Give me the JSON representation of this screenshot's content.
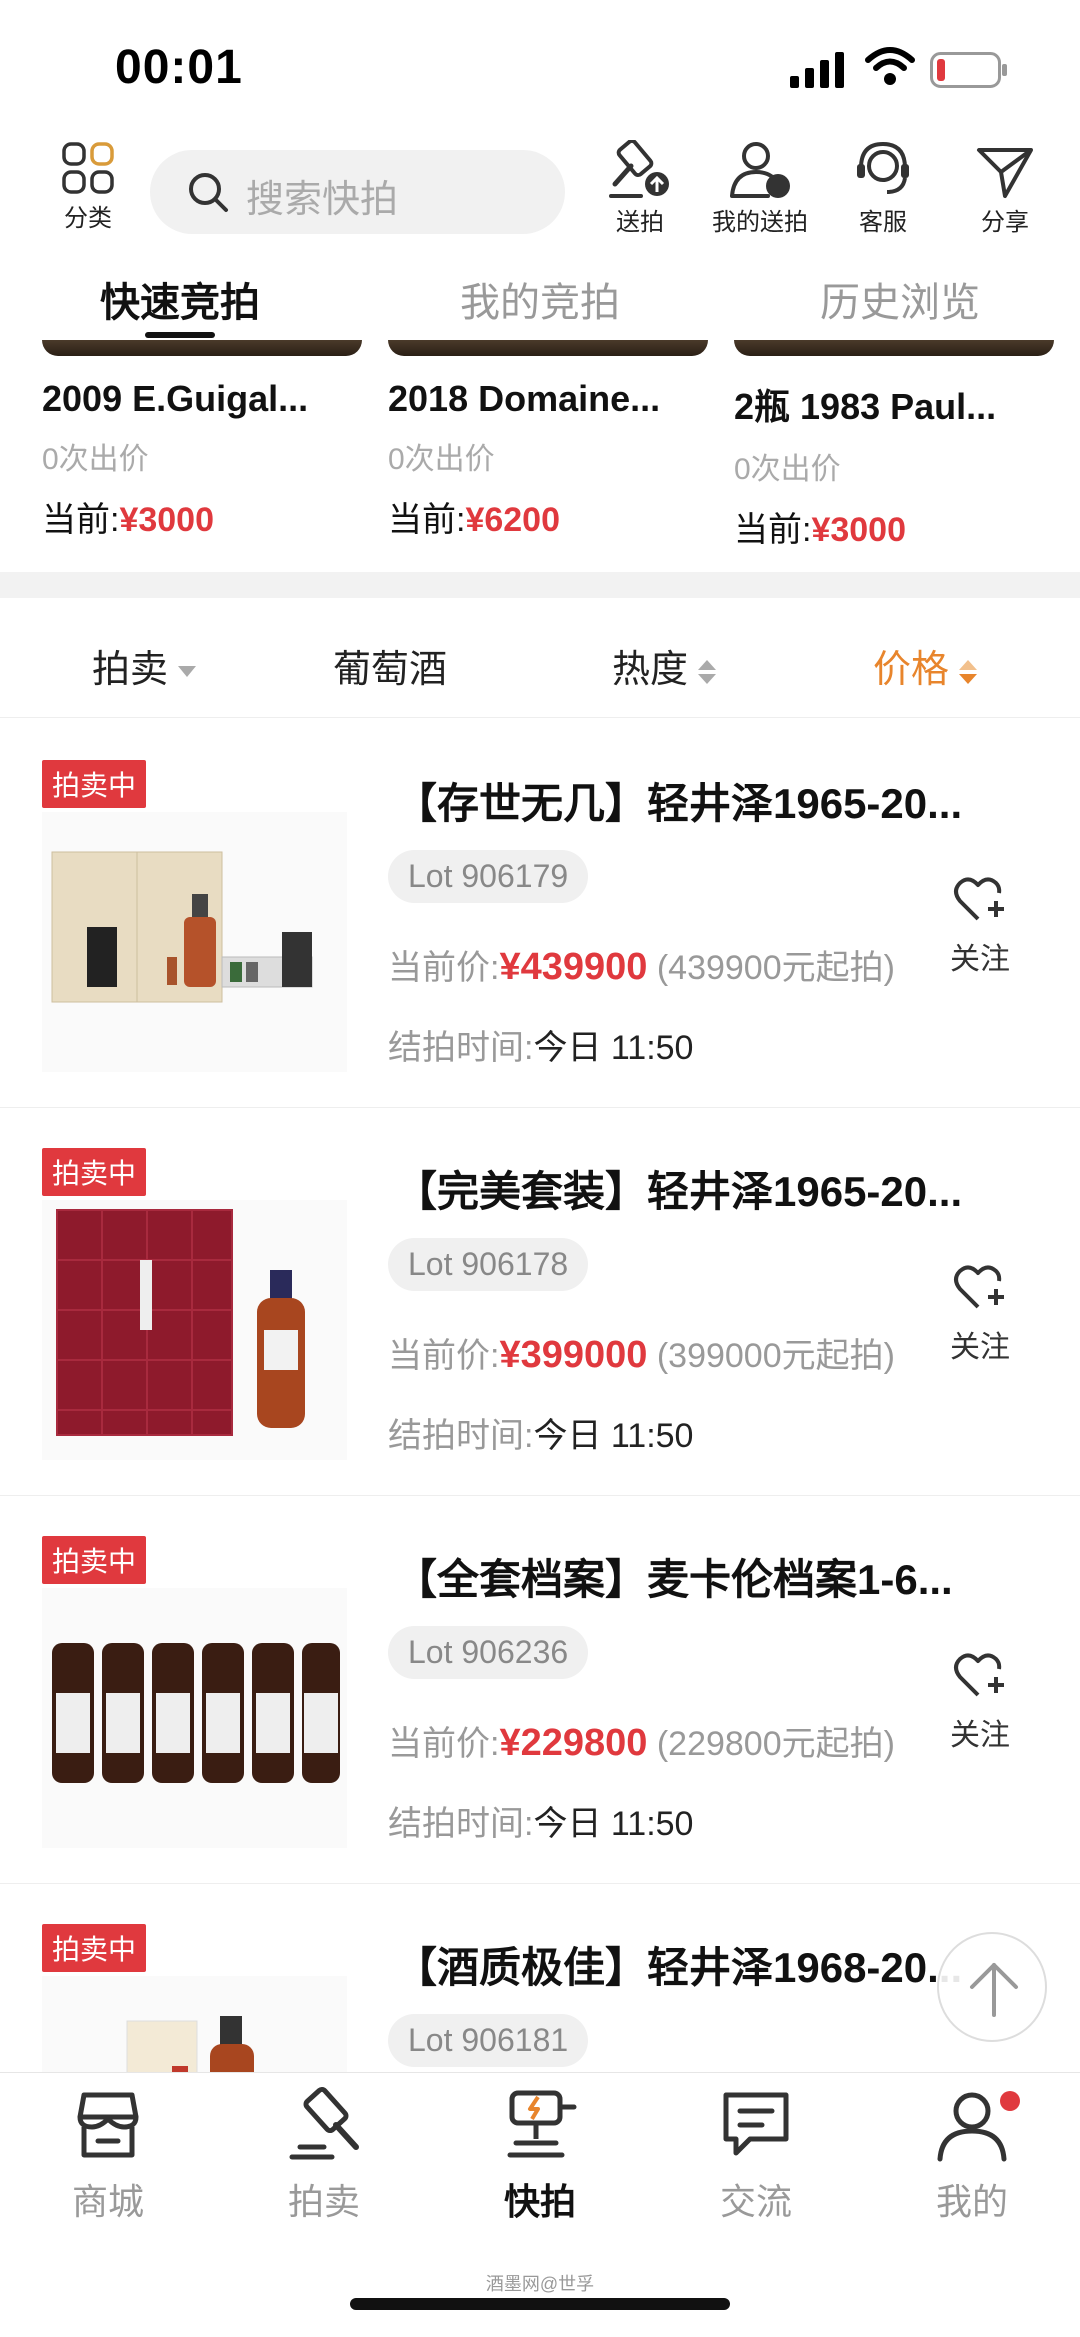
{
  "status_bar": {
    "time": "00:01"
  },
  "top_bar": {
    "category_label": "分类",
    "search_placeholder": "搜索快拍",
    "send_auction_label": "送拍",
    "my_send_label": "我的送拍",
    "service_label": "客服",
    "share_label": "分享"
  },
  "tabs": [
    {
      "label": "快速竞拍",
      "active": true
    },
    {
      "label": "我的竞拍",
      "active": false
    },
    {
      "label": "历史浏览",
      "active": false
    }
  ],
  "quick_cards": [
    {
      "title": "2009 E.Guigal...",
      "bids": "0次出价",
      "price_label": "当前:",
      "price": "¥3000"
    },
    {
      "title": "2018 Domaine...",
      "bids": "0次出价",
      "price_label": "当前:",
      "price": "¥6200"
    },
    {
      "title": "2瓶 1983 Paul...",
      "bids": "0次出价",
      "price_label": "当前:",
      "price": "¥3000"
    }
  ],
  "filters": [
    {
      "label": "拍卖",
      "control": "dropdown"
    },
    {
      "label": "葡萄酒",
      "control": "none"
    },
    {
      "label": "热度",
      "control": "sort"
    },
    {
      "label": "价格",
      "control": "sort",
      "active": true
    }
  ],
  "items": [
    {
      "badge": "拍卖中",
      "title": "【存世无几】轻井泽1965-20...",
      "lot": "Lot 906179",
      "price_label": "当前价:",
      "price": "¥439900",
      "start_note": "(439900元起拍)",
      "end_label": "结拍时间:",
      "end_time": "今日 11:50",
      "follow_label": "关注"
    },
    {
      "badge": "拍卖中",
      "title": "【完美套装】轻井泽1965-20...",
      "lot": "Lot 906178",
      "price_label": "当前价:",
      "price": "¥399000",
      "start_note": "(399000元起拍)",
      "end_label": "结拍时间:",
      "end_time": "今日 11:50",
      "follow_label": "关注"
    },
    {
      "badge": "拍卖中",
      "title": "【全套档案】麦卡伦档案1-6...",
      "lot": "Lot 906236",
      "price_label": "当前价:",
      "price": "¥229800",
      "start_note": "(229800元起拍)",
      "end_label": "结拍时间:",
      "end_time": "今日 11:50",
      "follow_label": "关注"
    },
    {
      "badge": "拍卖中",
      "title": "【酒质极佳】轻井泽1968-20...",
      "lot": "Lot 906181"
    }
  ],
  "bottom_nav": [
    {
      "label": "商城",
      "icon": "shop-icon"
    },
    {
      "label": "拍卖",
      "icon": "gavel-icon"
    },
    {
      "label": "快拍",
      "icon": "quick-auction-icon",
      "active": true
    },
    {
      "label": "交流",
      "icon": "chat-icon"
    },
    {
      "label": "我的",
      "icon": "user-icon"
    }
  ],
  "watermark": "酒墨网@世孚",
  "colors": {
    "accent_red": "#e0393e",
    "accent_orange": "#e8852c"
  }
}
